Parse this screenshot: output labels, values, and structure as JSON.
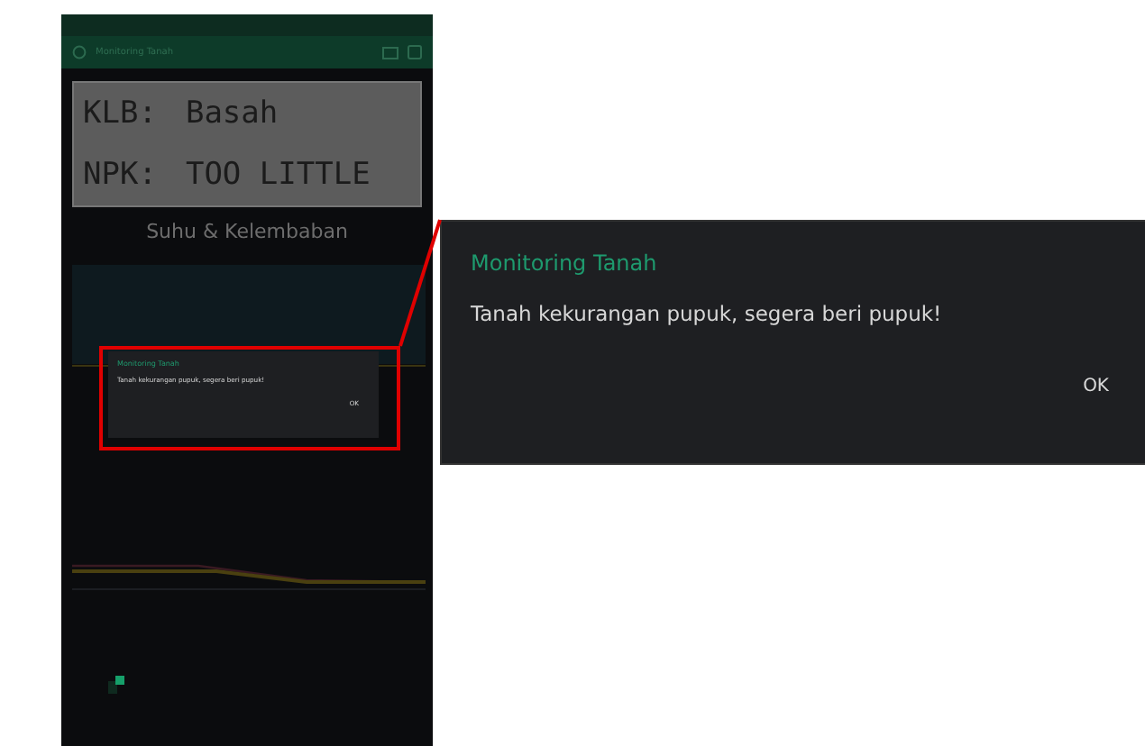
{
  "phone": {
    "app_bar": {
      "title": "Monitoring Tanah"
    },
    "lcd": [
      {
        "label": "KLB:",
        "value": "Basah"
      },
      {
        "label": "NPK:",
        "value": "TOO LITTLE"
      }
    ],
    "chart": {
      "title": "Suhu & Kelembaban"
    },
    "dialog": {
      "title": "Monitoring Tanah",
      "message": "Tanah kekurangan pupuk, segera beri pupuk!",
      "button": "OK"
    }
  },
  "zoomed_dialog": {
    "title": "Monitoring Tanah",
    "message": "Tanah kekurangan pupuk, segera beri pupuk!",
    "button": "OK"
  }
}
